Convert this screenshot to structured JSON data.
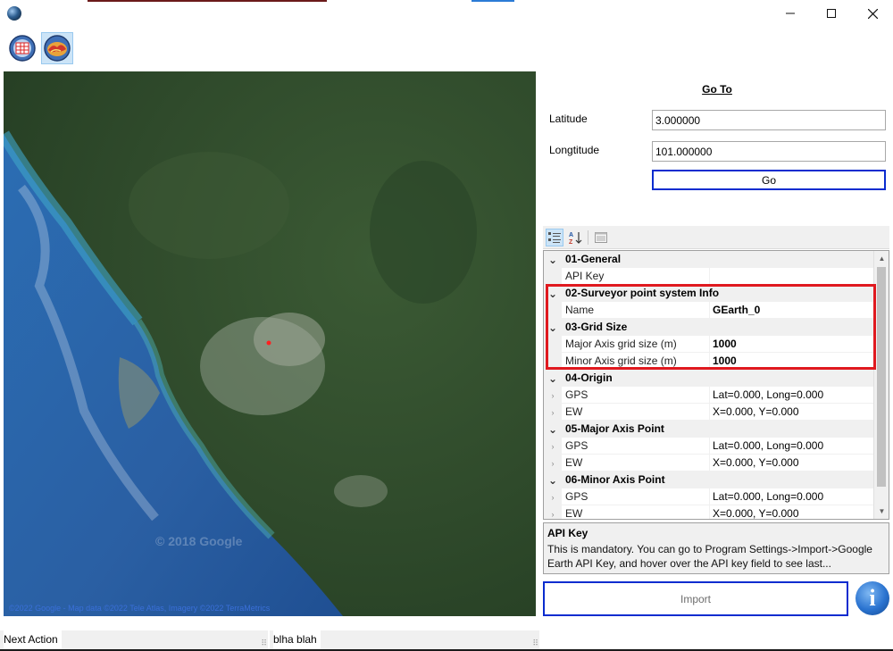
{
  "window": {
    "minimize_icon": "minimize-icon",
    "maximize_icon": "maximize-icon",
    "close_icon": "close-icon"
  },
  "toolbar": {
    "buttons": [
      {
        "icon": "grid-globe-icon"
      },
      {
        "icon": "terrain-globe-icon",
        "active": true
      }
    ]
  },
  "map": {
    "attribution": "©2022 Google - Map data ©2022 Tele Atlas, Imagery ©2022 TerraMetrics",
    "watermark": "© 2018 Google"
  },
  "goto": {
    "title": "Go To",
    "latitude_label": "Latitude",
    "latitude_value": "3.000000",
    "longitude_label": "Longtitude",
    "longitude_value": "101.000000",
    "go_label": "Go"
  },
  "property_grid": {
    "tools": [
      "categorized-icon",
      "alphabetical-icon",
      "property-pages-icon"
    ],
    "rows": [
      {
        "kind": "cat",
        "name": "01-General"
      },
      {
        "kind": "prop",
        "name": "API Key",
        "value": "",
        "bold": false
      },
      {
        "kind": "cat",
        "name": "02-Surveyor point system Info"
      },
      {
        "kind": "prop",
        "name": "Name",
        "value": "GEarth_0",
        "bold": true
      },
      {
        "kind": "cat",
        "name": "03-Grid Size"
      },
      {
        "kind": "prop",
        "name": "Major Axis grid size (m)",
        "value": "1000",
        "bold": true
      },
      {
        "kind": "prop",
        "name": "Minor Axis grid size (m)",
        "value": "1000",
        "bold": true
      },
      {
        "kind": "cat",
        "name": "04-Origin"
      },
      {
        "kind": "prop",
        "name": "GPS",
        "value": "Lat=0.000, Long=0.000",
        "bold": false,
        "expandable": true
      },
      {
        "kind": "prop",
        "name": "EW",
        "value": "X=0.000, Y=0.000",
        "bold": false,
        "expandable": true
      },
      {
        "kind": "cat",
        "name": "05-Major Axis Point"
      },
      {
        "kind": "prop",
        "name": "GPS",
        "value": "Lat=0.000, Long=0.000",
        "bold": false,
        "expandable": true
      },
      {
        "kind": "prop",
        "name": "EW",
        "value": "X=0.000, Y=0.000",
        "bold": false,
        "expandable": true
      },
      {
        "kind": "cat",
        "name": "06-Minor Axis Point"
      },
      {
        "kind": "prop",
        "name": "GPS",
        "value": "Lat=0.000, Long=0.000",
        "bold": false,
        "expandable": true
      },
      {
        "kind": "prop",
        "name": "EW",
        "value": "X=0.000, Y=0.000",
        "bold": false,
        "expandable": true
      }
    ],
    "help_title": "API Key",
    "help_body": "This is mandatory. You can go to Program Settings->Import->Google Earth API Key, and hover over the API key field to see last..."
  },
  "import_label": "Import",
  "info_glyph": "i",
  "status": {
    "left": "Next Action",
    "right": "blha blah"
  },
  "colors": {
    "highlight": "#e0191f",
    "focus_border": "#0a2ccf",
    "category_bg": "#f0f0f0"
  }
}
